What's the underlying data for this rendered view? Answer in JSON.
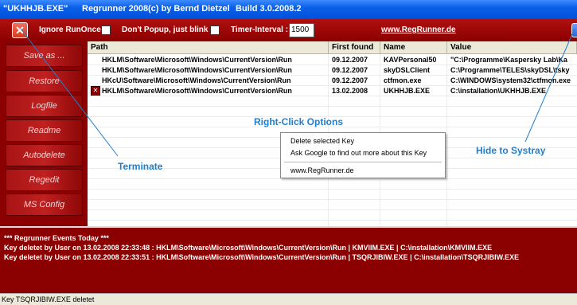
{
  "window": {
    "title_exe": "\"UKHHJB.EXE\"",
    "title_app": "Regrunner 2008",
    "title_copyright": "(c) by Bernd Dietzel",
    "title_build": "Build 3.0.2008.2"
  },
  "toolbar": {
    "ignore_runonce_label": "Ignore RunOnce",
    "dont_popup_label": "Don't Popup, just blink",
    "timer_label": "Timer-Interval :",
    "timer_value": "1500",
    "website_link": "www.RegRunner.de"
  },
  "sidebar": {
    "items": [
      {
        "label": "Save as ..."
      },
      {
        "label": "Restore"
      },
      {
        "label": "Logfile"
      },
      {
        "label": "Readme"
      },
      {
        "label": "Autodelete"
      },
      {
        "label": "Regedit"
      },
      {
        "label": "MS Config"
      }
    ]
  },
  "table": {
    "columns": [
      "Path",
      "First found",
      "Name",
      "Value"
    ],
    "rows": [
      {
        "path": "HKLM\\Software\\Microsoft\\Windows\\CurrentVersion\\Run",
        "first_found": "09.12.2007",
        "name": "KAVPersonal50",
        "value": "\"C:\\Programme\\Kaspersky Lab\\Ka"
      },
      {
        "path": "HKLM\\Software\\Microsoft\\Windows\\CurrentVersion\\Run",
        "first_found": "09.12.2007",
        "name": "skyDSLClient",
        "value": "C:\\Programme\\TELES\\skyDSL\\tsky"
      },
      {
        "path": "HKcU\\Software\\Microsoft\\Windows\\CurrentVersion\\Run",
        "first_found": "09.12.2007",
        "name": "ctfmon.exe",
        "value": "C:\\WINDOWS\\system32\\ctfmon.exe"
      },
      {
        "path": "HKLM\\Software\\Microsoft\\Windows\\CurrentVersion\\Run",
        "first_found": "13.02.2008",
        "name": "UKHHJB.EXE",
        "value": "C:\\installation\\UKHHJB.EXE"
      }
    ]
  },
  "annotations": {
    "right_click": "Right-Click Options",
    "terminate": "Terminate",
    "hide": "Hide to Systray"
  },
  "context_menu": {
    "items": [
      "Delete selected Key",
      "Ask Google to find out more about this Key",
      "www.RegRunner.de"
    ]
  },
  "events": {
    "header": "*** Regrunner Events Today ***",
    "lines": [
      "Key deletet by User on 13.02.2008 22:33:48 : HKLM\\Software\\Microsoft\\Windows\\CurrentVersion\\Run | KMVIIM.EXE | C:\\installation\\KMVIIM.EXE",
      "Key deletet by User on 13.02.2008 22:33:51 : HKLM\\Software\\Microsoft\\Windows\\CurrentVersion\\Run | TSQRJIBIW.EXE | C:\\installation\\TSQRJIBIW.EXE"
    ]
  },
  "status": {
    "text": "Key TSQRJIBIW.EXE deletet"
  },
  "colors": {
    "title_blue": "#0a5fe8",
    "dark_red": "#8b0000",
    "annotation_blue": "#1f7fd1"
  }
}
